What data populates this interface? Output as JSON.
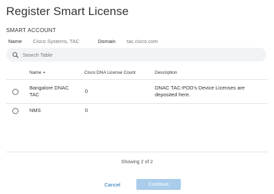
{
  "dialog": {
    "title": "Register Smart License",
    "section": "SMART ACCOUNT",
    "name_label": "Name",
    "name_value": "Cisco Systems, TAC",
    "domain_label": "Domain",
    "domain_value": "tac.cisco.com"
  },
  "search": {
    "placeholder": "Search Table",
    "icon": "search-icon"
  },
  "table": {
    "columns": {
      "name": "Name",
      "sort_indicator": "▲",
      "count": "Cisco DNA License Count",
      "description": "Description"
    },
    "rows": [
      {
        "name_line1": "Bangalore DNAC",
        "name_line2": "TAC",
        "count": "0",
        "desc_line1": "DNAC TAC-POD's Device Licenses are",
        "desc_line2": "deposited here."
      },
      {
        "name_line1": "NMS",
        "count": "0"
      }
    ]
  },
  "footer": {
    "showing": "Showing 2 of 2",
    "cancel_label": "Cancel",
    "continue_label": "Continue"
  },
  "colors": {
    "link": "#1a6fb3",
    "primary_disabled": "#a9cdea",
    "search_bg": "#f1f3f5"
  }
}
